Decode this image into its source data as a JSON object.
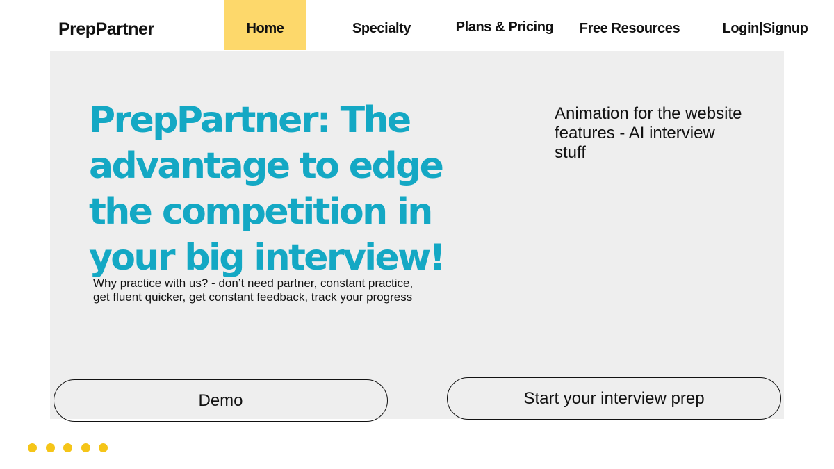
{
  "header": {
    "brand": "PrepPartner",
    "nav": {
      "home": "Home",
      "specialty": "Specialty",
      "plans": "Plans & Pricing",
      "free_resources": "Free Resources",
      "login": "Login|Signup"
    },
    "active_item": "home",
    "active_color": "#fdd86b"
  },
  "hero": {
    "headline": "PrepPartner: The advantage to edge the competition in your big interview!",
    "headline_color": "#14a8c4",
    "why_text": "Why practice with us? - don’t need partner, constant practice, get fluent quicker, get constant feedback, track your progress",
    "animation_note": "Animation for the website features - AI interview stuff",
    "panel_color": "#eeeeee"
  },
  "buttons": {
    "demo": "Demo",
    "start": "Start your interview prep"
  },
  "carousel": {
    "dot_count": 5,
    "dot_color": "#f5c518",
    "dot_icon": "dot-icon"
  }
}
